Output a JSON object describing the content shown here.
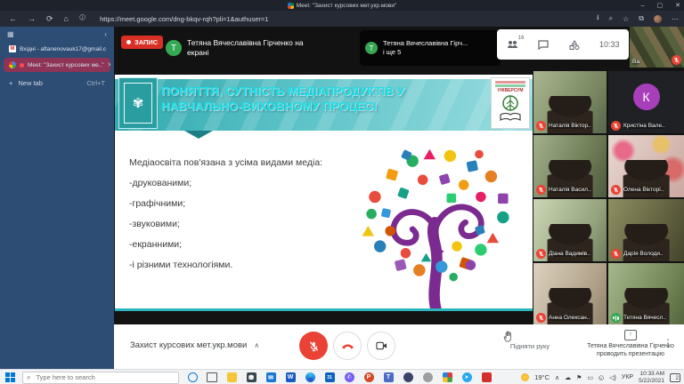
{
  "browser": {
    "window_title": "Меet: \"Захист курсових мет.укр.мови\"",
    "url": "https://meet.google.com/dng-bkqv-rqh?pli=1&authuser=1",
    "tabs": [
      {
        "label": "Вхідні - aftanenovauk17@gmail.c"
      },
      {
        "label": "Meet: \"Захист курсових ме..\""
      }
    ],
    "new_tab_label": "New tab",
    "new_tab_shortcut": "Ctrl+T"
  },
  "meet": {
    "recording_label": "ЗАПИС",
    "presenter_tile": {
      "avatar_letter": "Т",
      "line1": "Тетяна Вячеславівна Гірченко на",
      "line2": "екрані"
    },
    "others_tile": {
      "avatar_letter": "Т",
      "line1": "Тетяна Вячеславівна Гірч...",
      "line2": "і ще 5"
    },
    "participants_count": "16",
    "clock": "10:33",
    "meeting_name": "Захист курсових мет.укр.мови",
    "raise_hand_label": "Підняти руку",
    "presenting_status_line1": "Тетяна Вячеславівна Гірченко",
    "presenting_status_line2": "проводить презентацію"
  },
  "slide": {
    "title_line1": "ПОНЯТТЯ, СУТНІСТЬ МЕДІАПРОДУКТІВ У",
    "title_line2": "НАВЧАЛЬНО-ВИХОВНОМУ ПРОЦЕСІ",
    "body_lines": [
      "Медіаосвіта пов'язана з усіма видами медіа:",
      "-друкованими;",
      "-графічними;",
      "-звуковими;",
      "-екранними;",
      "-і різними технологіями."
    ],
    "logo_right_text": "УНІВЕРСУМ"
  },
  "participants": [
    {
      "name": "Ва",
      "mic": "muted"
    },
    {
      "name": "Наталія Віктор..",
      "mic": "muted"
    },
    {
      "name": "Кристіна Вале..",
      "mic": "muted",
      "avatar_letter": "К"
    },
    {
      "name": "Наталія Васил..",
      "mic": "muted"
    },
    {
      "name": "Олена Вікторі..",
      "mic": "muted"
    },
    {
      "name": "Діана Вадимів..",
      "mic": "muted"
    },
    {
      "name": "Дарія Володи..",
      "mic": "muted"
    },
    {
      "name": "Анна Олексан..",
      "mic": "muted"
    },
    {
      "name": "Тетяна Вячесл..",
      "mic": "speaking"
    }
  ],
  "taskbar": {
    "search_placeholder": "Type here to search",
    "weather_temp": "19°C",
    "language": "УКР",
    "time": "10:33 AM",
    "date": "5/22/2021",
    "notification_count": "2"
  },
  "colors": {
    "record_red": "#d93025",
    "meet_green": "#34a853",
    "mute_red": "#ea4335",
    "slide_teal": "#2ab6bd",
    "slide_title_cyan": "#17dfe9",
    "sidebar_blue": "#2e4d74",
    "active_tab_rose": "#8e3456",
    "tree_purple": "#7b2a8f"
  }
}
